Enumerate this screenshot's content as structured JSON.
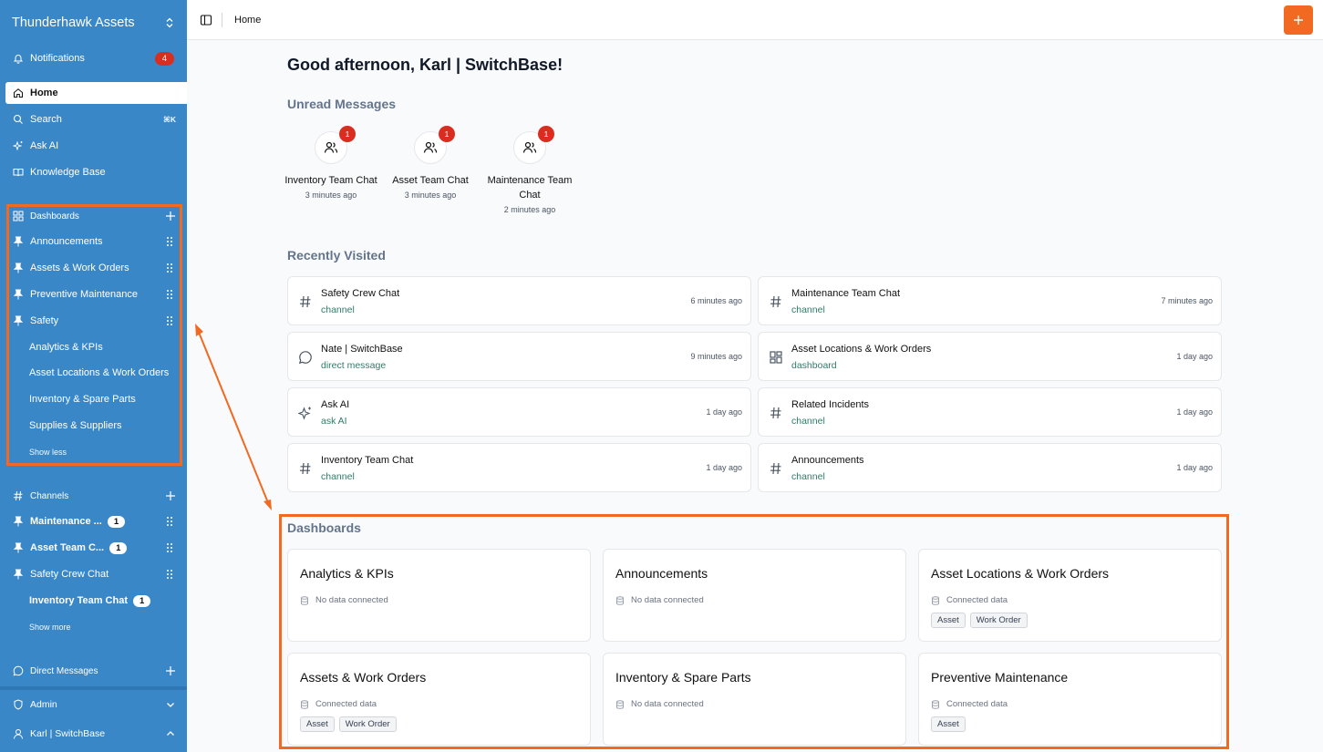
{
  "sidebar": {
    "workspace": "Thunderhawk Assets",
    "notifications": {
      "label": "Notifications",
      "count": "4"
    },
    "nav": {
      "home": "Home",
      "search": "Search",
      "search_shortcut": "⌘K",
      "ask_ai": "Ask AI",
      "knowledge_base": "Knowledge Base"
    },
    "dashboards": {
      "header": "Dashboards",
      "pinned": [
        "Announcements",
        "Assets & Work Orders",
        "Preventive Maintenance",
        "Safety"
      ],
      "others": [
        "Analytics & KPIs",
        "Asset Locations & Work Orders",
        "Inventory & Spare Parts",
        "Supplies & Suppliers"
      ],
      "toggle": "Show less"
    },
    "channels": {
      "header": "Channels",
      "items": [
        {
          "label": "Maintenance ...",
          "count": "1"
        },
        {
          "label": "Asset Team C...",
          "count": "1"
        },
        {
          "label": "Safety Crew Chat",
          "count": ""
        },
        {
          "label": "Inventory Team Chat",
          "count": "1"
        }
      ],
      "toggle": "Show more"
    },
    "direct_messages": "Direct Messages",
    "admin": "Admin",
    "user": "Karl | SwitchBase"
  },
  "topbar": {
    "breadcrumb": "Home"
  },
  "main": {
    "greeting": "Good afternoon, Karl | SwitchBase!",
    "unread_title": "Unread Messages",
    "unread": [
      {
        "name": "Inventory Team Chat",
        "time": "3 minutes ago",
        "count": "1"
      },
      {
        "name": "Asset Team Chat",
        "time": "3 minutes ago",
        "count": "1"
      },
      {
        "name": "Maintenance Team Chat",
        "time": "2 minutes ago",
        "count": "1"
      }
    ],
    "recent_title": "Recently Visited",
    "recent": [
      {
        "title": "Safety Crew Chat",
        "type": "channel",
        "time": "6 minutes ago",
        "icon": "hash-icon"
      },
      {
        "title": "Maintenance Team Chat",
        "type": "channel",
        "time": "7 minutes ago",
        "icon": "hash-icon"
      },
      {
        "title": "Nate | SwitchBase",
        "type": "direct message",
        "time": "9 minutes ago",
        "icon": "message-icon"
      },
      {
        "title": "Asset Locations & Work Orders",
        "type": "dashboard",
        "time": "1 day ago",
        "icon": "dashboard-icon"
      },
      {
        "title": "Ask AI",
        "type": "ask AI",
        "time": "1 day ago",
        "icon": "sparkle-icon"
      },
      {
        "title": "Related Incidents",
        "type": "channel",
        "time": "1 day ago",
        "icon": "hash-icon"
      },
      {
        "title": "Inventory Team Chat",
        "type": "channel",
        "time": "1 day ago",
        "icon": "hash-icon"
      },
      {
        "title": "Announcements",
        "type": "channel",
        "time": "1 day ago",
        "icon": "hash-icon"
      }
    ],
    "dashboards_title": "Dashboards",
    "dashboards": [
      {
        "title": "Analytics & KPIs",
        "meta": "No data connected",
        "tags": []
      },
      {
        "title": "Announcements",
        "meta": "No data connected",
        "tags": []
      },
      {
        "title": "Asset Locations & Work Orders",
        "meta": "Connected data",
        "tags": [
          "Asset",
          "Work Order"
        ]
      },
      {
        "title": "Assets & Work Orders",
        "meta": "Connected data",
        "tags": [
          "Asset",
          "Work Order"
        ]
      },
      {
        "title": "Inventory & Spare Parts",
        "meta": "No data connected",
        "tags": []
      },
      {
        "title": "Preventive Maintenance",
        "meta": "Connected data",
        "tags": [
          "Asset"
        ]
      }
    ]
  },
  "colors": {
    "sidebar": "#3a87c7",
    "accent": "#f26a21",
    "badge": "#d92d20",
    "link_green": "#2e7d67"
  }
}
